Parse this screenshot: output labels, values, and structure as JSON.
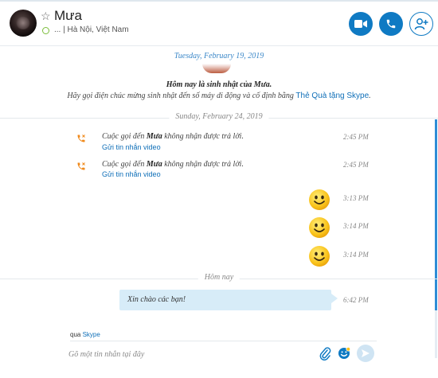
{
  "header": {
    "contact_name": "Mưa",
    "mood": "... | Hà Nội, Việt Nam",
    "favorite_icon": "star-icon",
    "presence_icon": "presence-ring-icon",
    "buttons": {
      "video": "video-camera-icon",
      "call": "phone-icon",
      "add": "add-person-icon"
    }
  },
  "conversation": {
    "birthday": {
      "date": "Tuesday, February 19, 2019",
      "title": "Hôm nay là sinh nhật của Mưa.",
      "subtitle_prefix": "Hãy gọi điện chúc mừng sinh nhật đến số máy di động và cố định bằng",
      "subtitle_link": "Thẻ Quà tặng Skype",
      "subtitle_suffix": "."
    },
    "day2": {
      "date": "Sunday, February 24, 2019",
      "calls": [
        {
          "prefix": "Cuộc gọi đến",
          "name": "Mưa",
          "suffix": "không nhận được trả lời.",
          "link": "Gửi tin nhắn video",
          "time": "2:45 PM"
        },
        {
          "prefix": "Cuộc gọi đến",
          "name": "Mưa",
          "suffix": "không nhận được trả lời.",
          "link": "Gửi tin nhắn video",
          "time": "2:45 PM"
        }
      ],
      "emoticons": [
        {
          "icon": "smiley-emoticon-icon",
          "time": "3:13 PM"
        },
        {
          "icon": "smiley-emoticon-icon",
          "time": "3:14 PM"
        },
        {
          "icon": "smiley-emoticon-icon",
          "time": "3:14 PM"
        }
      ]
    },
    "today": {
      "label": "Hôm nay",
      "message": "Xin chào các bạn!",
      "time": "6:42 PM"
    }
  },
  "compose": {
    "via_prefix": "qua",
    "via_service": "Skype",
    "placeholder": "Gõ một tin nhắn tại đây",
    "icons": [
      "paperclip-icon",
      "emoticon-icon",
      "send-icon"
    ]
  },
  "colors": {
    "accent": "#0f7ac3",
    "link": "#0f6fb8",
    "bubble": "#d7ecf8",
    "presence": "#7bbd3a",
    "missed_call": "#f08a1c"
  }
}
